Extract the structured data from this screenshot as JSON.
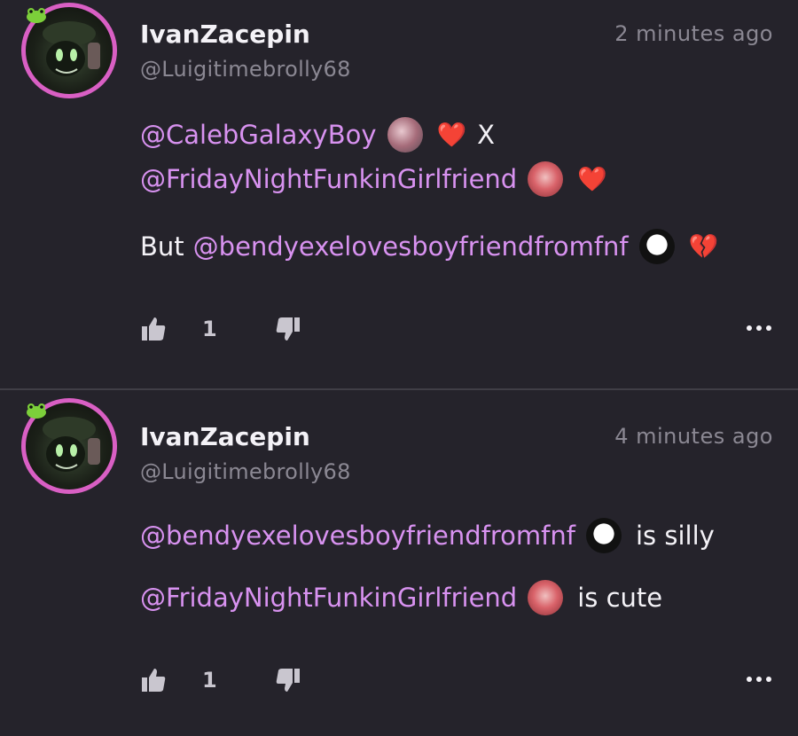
{
  "comments": [
    {
      "username": "IvanZacepin",
      "handle": "@Luigitimebrolly68",
      "time": "2 minutes ago",
      "lines": [
        {
          "m1": "@CalebGalaxyBoy",
          "x": "X"
        },
        {
          "m1": "@FridayNightFunkinGirlfriend"
        },
        {
          "prefix": "But",
          "m1": "@bendyexelovesboyfriendfromfnf"
        }
      ],
      "likes": "1"
    },
    {
      "username": "IvanZacepin",
      "handle": "@Luigitimebrolly68",
      "time": "4 minutes ago",
      "lines": [
        {
          "m1": "@bendyexelovesboyfriendfromfnf",
          "suffix": "is silly"
        },
        {
          "m1": "@FridayNightFunkinGirlfriend",
          "suffix": "is cute"
        }
      ],
      "likes": "1"
    }
  ],
  "emojis": {
    "heart": "❤️",
    "broken_heart": "💔"
  },
  "icons": [
    "frog-icon",
    "thumbs-up-icon",
    "thumbs-down-icon",
    "more-options-icon"
  ],
  "colors": {
    "background": "#25232b",
    "mention": "#d892f0",
    "avatar_ring": "#d95fc4",
    "muted": "#8b8893"
  }
}
